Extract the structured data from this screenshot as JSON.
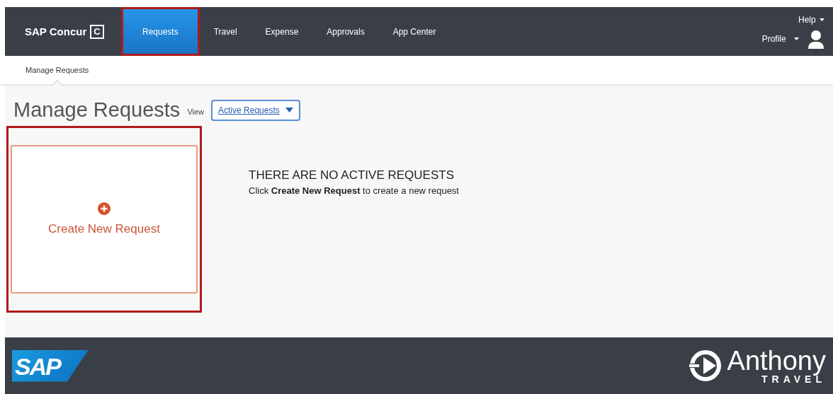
{
  "header": {
    "brand": "SAP Concur",
    "brand_mark": "C",
    "tabs": [
      {
        "label": "Requests",
        "selected": true,
        "highlighted": true
      },
      {
        "label": "Travel",
        "selected": false,
        "highlighted": false
      },
      {
        "label": "Expense",
        "selected": false,
        "highlighted": false
      },
      {
        "label": "Approvals",
        "selected": false,
        "highlighted": false
      },
      {
        "label": "App Center",
        "selected": false,
        "highlighted": false
      }
    ],
    "help": "Help",
    "profile": "Profile"
  },
  "subnav": {
    "items": [
      {
        "label": "Manage Requests",
        "selected": true
      }
    ]
  },
  "page": {
    "title": "Manage Requests",
    "view_label": "View",
    "view_select": "Active Requests",
    "create_card": {
      "label": "Create New Request",
      "highlighted": true
    },
    "empty_title": "THERE ARE NO ACTIVE REQUESTS",
    "empty_hint": "Click **Create New Request** to create a new request"
  },
  "footer": {
    "left_logo": "SAP",
    "right_logo": "Anthony",
    "right_logo_sub": "TRAVEL"
  }
}
